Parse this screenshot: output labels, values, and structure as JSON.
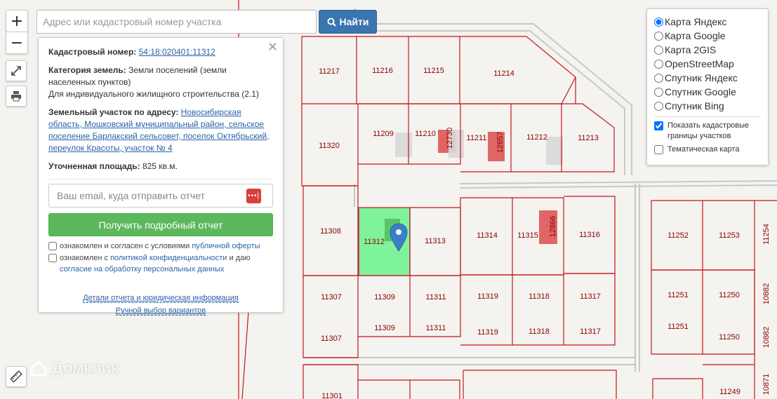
{
  "search": {
    "placeholder": "Адрес или кадастровый номер участка",
    "button_label": "Найти"
  },
  "controls": {
    "zoom_in": "+",
    "zoom_out": "−"
  },
  "info": {
    "cadastral_label": "Кадастровый номер:",
    "cadastral_number": "54:18:020401:11312",
    "category_label": "Категория земель:",
    "category_value": "Земли поселений (земли населенных пунктов)",
    "use_value": "Для индивидуального жилищного строительства (2.1)",
    "address_label": "Земельный участок по адресу:",
    "address_value": "Новосибирская область, Мошковский муниципальный район, сельское поселение Барлакский сельсовет, поселок Октябрьский, переулок Красоты, участок № 4",
    "area_label": "Уточненная площадь:",
    "area_value": "825 кв.м.",
    "email_placeholder": "Ваш email, куда отправить отчет",
    "report_button": "Получить подробный отчет",
    "consent1_text": "ознакомлен и согласен с условиями",
    "consent1_link": "публичной оферты",
    "consent2_text": "ознакомлен с",
    "consent2_link": "политикой конфиденциальности",
    "consent2_mid": "и даю",
    "consent2_link2": "согласие на обработку персональных данных",
    "details_link": "Детали отчета и юридическая информация",
    "manual_link": "Ручной выбор вариантов"
  },
  "layers": {
    "options": [
      {
        "label": "Карта Яндекс",
        "selected": true
      },
      {
        "label": "Карта Google",
        "selected": false
      },
      {
        "label": "Карта 2GIS",
        "selected": false
      },
      {
        "label": "OpenStreetMap",
        "selected": false
      },
      {
        "label": "Спутник Яндекс",
        "selected": false
      },
      {
        "label": "Спутник Google",
        "selected": false
      },
      {
        "label": "Спутник Bing",
        "selected": false
      }
    ],
    "show_borders": "Показать кадастровые границы участков",
    "thematic": "Тематическая карта"
  },
  "map": {
    "parcels": [
      "11217",
      "11216",
      "11215",
      "11214",
      "11320",
      "11209",
      "11210",
      "11211",
      "11212",
      "11213",
      "12730",
      "12857",
      "11308",
      "11312",
      "11313",
      "11314",
      "11315",
      "11316",
      "12866",
      "11307",
      "11309",
      "11311",
      "11319",
      "11318",
      "11317",
      "11301",
      "11252",
      "11253",
      "11254",
      "11251",
      "11250",
      "10882",
      "11249",
      "10871"
    ],
    "selected_color": "#7ef39c",
    "border_color": "#c4161c"
  },
  "watermark": "Домклик"
}
